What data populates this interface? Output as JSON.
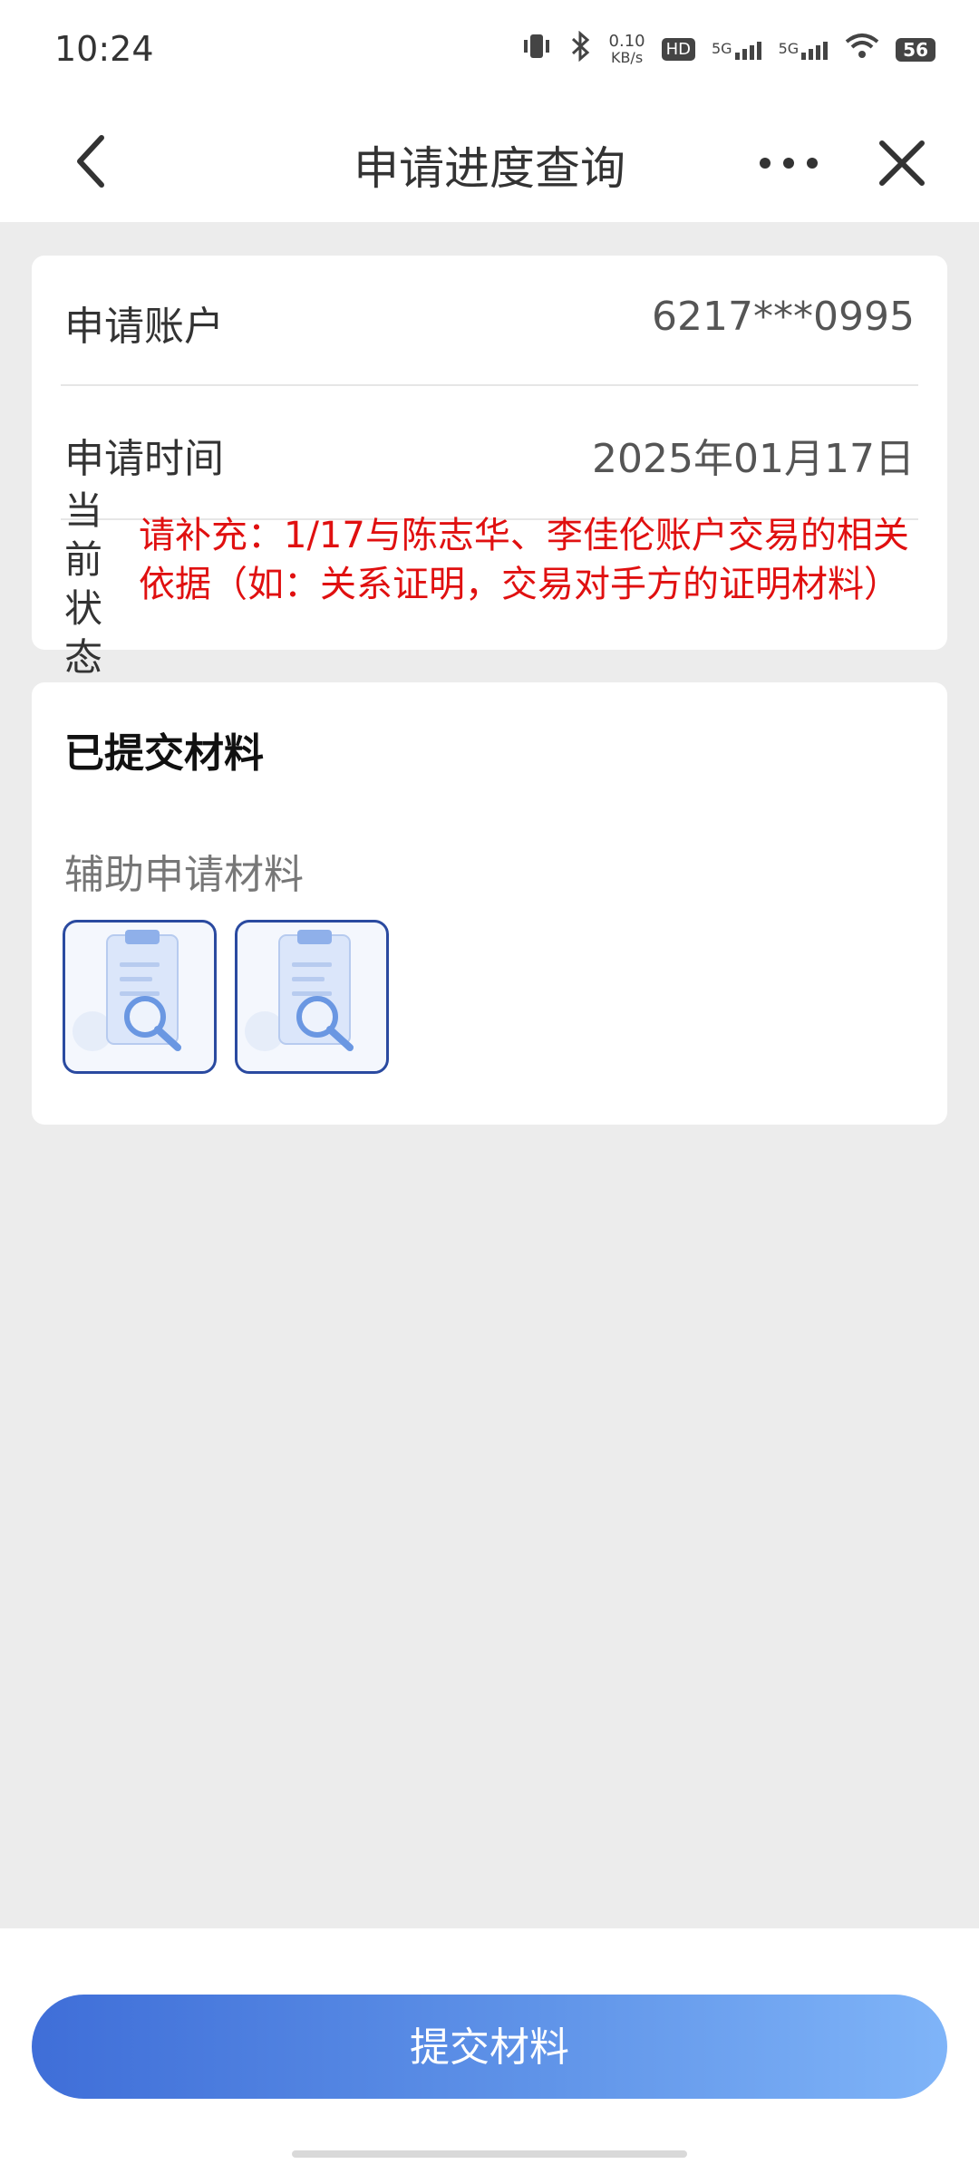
{
  "status_bar": {
    "time": "10:24",
    "net_speed_value": "0.10",
    "net_speed_unit": "KB/s",
    "hd_label": "HD",
    "signal1_label": "5G",
    "signal2_label": "5G",
    "battery": "56"
  },
  "nav": {
    "title": "申请进度查询"
  },
  "info": {
    "account_label": "申请账户",
    "account_value": "6217***0995",
    "time_label": "申请时间",
    "time_value": "2025年01月17日",
    "status_label": "当前状态",
    "status_text": "请补充：1/17与陈志华、李佳伦账户交易的相关依据（如：关系证明，交易对手方的证明材料）"
  },
  "materials": {
    "section_title": "已提交材料",
    "sub_title": "辅助申请材料",
    "items": [
      {
        "icon": "document-search-icon"
      },
      {
        "icon": "document-search-icon"
      }
    ]
  },
  "footer": {
    "submit_label": "提交材料"
  },
  "colors": {
    "status_text": "#e01010",
    "button_start": "#3f6ed8",
    "button_end": "#7fb4f8",
    "thumb_border": "#2a4aa0"
  }
}
